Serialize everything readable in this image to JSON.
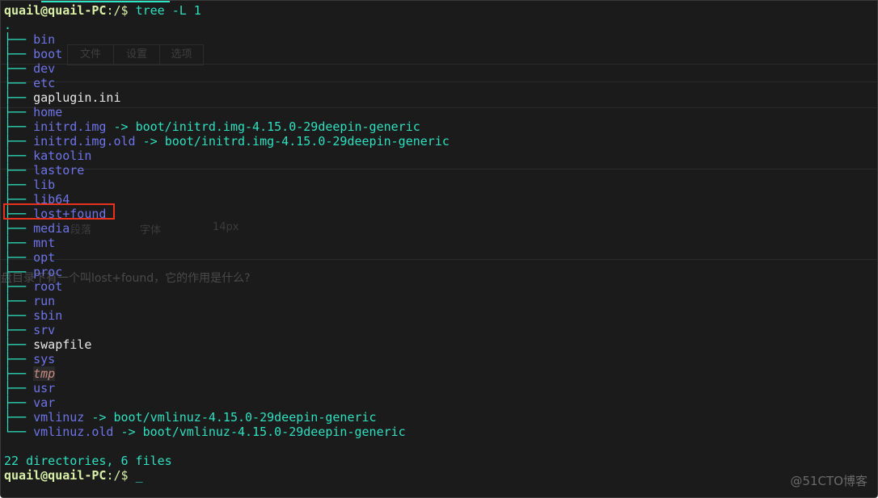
{
  "prompt": {
    "user_host": "quail@quail-PC",
    "path": ":/",
    "symbol": "$ "
  },
  "command": "tree -L 1",
  "root": ".",
  "entries": [
    {
      "name": "bin",
      "type": "dir"
    },
    {
      "name": "boot",
      "type": "dir"
    },
    {
      "name": "dev",
      "type": "dir"
    },
    {
      "name": "etc",
      "type": "dir"
    },
    {
      "name": "gaplugin.ini",
      "type": "file"
    },
    {
      "name": "home",
      "type": "dir"
    },
    {
      "name": "initrd.img",
      "type": "link",
      "target": "boot/initrd.img-4.15.0-29deepin-generic"
    },
    {
      "name": "initrd.img.old",
      "type": "link",
      "target": "boot/initrd.img-4.15.0-29deepin-generic"
    },
    {
      "name": "katoolin",
      "type": "dir"
    },
    {
      "name": "lastore",
      "type": "dir"
    },
    {
      "name": "lib",
      "type": "dir"
    },
    {
      "name": "lib64",
      "type": "dir"
    },
    {
      "name": "lost+found",
      "type": "dir",
      "highlighted": true
    },
    {
      "name": "media",
      "type": "dir"
    },
    {
      "name": "mnt",
      "type": "dir"
    },
    {
      "name": "opt",
      "type": "dir"
    },
    {
      "name": "proc",
      "type": "dir"
    },
    {
      "name": "root",
      "type": "dir"
    },
    {
      "name": "run",
      "type": "dir"
    },
    {
      "name": "sbin",
      "type": "dir"
    },
    {
      "name": "srv",
      "type": "dir"
    },
    {
      "name": "swapfile",
      "type": "file"
    },
    {
      "name": "sys",
      "type": "dir"
    },
    {
      "name": "tmp",
      "type": "tmp"
    },
    {
      "name": "usr",
      "type": "dir"
    },
    {
      "name": "var",
      "type": "dir"
    },
    {
      "name": "vmlinuz",
      "type": "link",
      "target": "boot/vmlinuz-4.15.0-29deepin-generic"
    },
    {
      "name": "vmlinuz.old",
      "type": "link",
      "target": "boot/vmlinuz-4.15.0-29deepin-generic"
    }
  ],
  "tree_branch": "├── ",
  "tree_last": "└── ",
  "arrow": " -> ",
  "summary": "22 directories, 6 files",
  "cursor": "_",
  "overlay": {
    "tabs": [
      "文件",
      "设置",
      "选项"
    ],
    "paragraph_select": "段落",
    "font_select": "字体",
    "size_select": "14px",
    "question": "盘目录下有一个叫lost+found，它的作用是什么?"
  },
  "watermark": "@51CTO博客",
  "colors": {
    "background": "#1b1b1b",
    "directory": "#6e74e8",
    "accent": "#2ee0c0",
    "highlight_box": "#e8321e"
  }
}
